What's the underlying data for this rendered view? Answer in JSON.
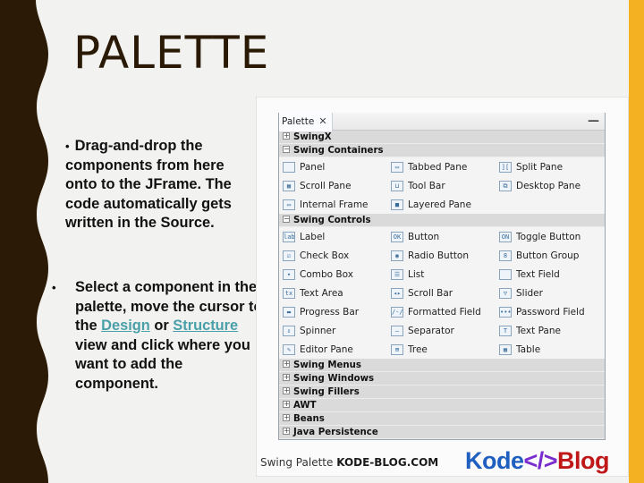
{
  "slide": {
    "title": "PALETTE",
    "colors": {
      "wave": "#2b1a05",
      "accent_strip": "#f4b223",
      "link": "#4aa0a8"
    }
  },
  "bullets": {
    "first": {
      "marker": "•",
      "text": "Drag-and-drop the components from here onto to the JFrame. The code automatically gets written in the Source."
    },
    "second": {
      "marker": "•",
      "text_before": "Select a component in the palette, move the cursor to the ",
      "link_design": "Design",
      "text_or": " or ",
      "link_structure": "Structure",
      "text_after": " view and click where you want to add the component."
    }
  },
  "palette": {
    "tab_label": "Palette",
    "close_glyph": "✕",
    "minimize_glyph": "—",
    "sections": {
      "swingx": {
        "toggle": "+",
        "label": "SwingX"
      },
      "containers": {
        "toggle": "−",
        "label": "Swing Containers",
        "items": [
          {
            "label": "Panel",
            "icon": "panel-icon",
            "glyph": ""
          },
          {
            "label": "Tabbed Pane",
            "icon": "tabbed-pane-icon",
            "glyph": "▭"
          },
          {
            "label": "Split Pane",
            "icon": "split-pane-icon",
            "glyph": "]["
          },
          {
            "label": "Scroll Pane",
            "icon": "scroll-pane-icon",
            "glyph": "▦"
          },
          {
            "label": "Tool Bar",
            "icon": "tool-bar-icon",
            "glyph": "⊔"
          },
          {
            "label": "Desktop Pane",
            "icon": "desktop-pane-icon",
            "glyph": "⧉"
          },
          {
            "label": "Internal Frame",
            "icon": "internal-frame-icon",
            "glyph": "▭"
          },
          {
            "label": "Layered Pane",
            "icon": "layered-pane-icon",
            "glyph": "■"
          }
        ]
      },
      "controls": {
        "toggle": "−",
        "label": "Swing Controls",
        "items": [
          {
            "label": "Label",
            "icon": "label-icon",
            "glyph": "labe"
          },
          {
            "label": "Button",
            "icon": "button-icon",
            "glyph": "OK"
          },
          {
            "label": "Toggle Button",
            "icon": "toggle-button-icon",
            "glyph": "ON"
          },
          {
            "label": "Check Box",
            "icon": "check-box-icon",
            "glyph": "☑"
          },
          {
            "label": "Radio Button",
            "icon": "radio-button-icon",
            "glyph": "◉"
          },
          {
            "label": "Button Group",
            "icon": "button-group-icon",
            "glyph": "8"
          },
          {
            "label": "Combo Box",
            "icon": "combo-box-icon",
            "glyph": "▾"
          },
          {
            "label": "List",
            "icon": "list-icon",
            "glyph": "☰"
          },
          {
            "label": "Text Field",
            "icon": "text-field-icon",
            "glyph": ""
          },
          {
            "label": "Text Area",
            "icon": "text-area-icon",
            "glyph": "tx"
          },
          {
            "label": "Scroll Bar",
            "icon": "scroll-bar-icon",
            "glyph": "◂▸"
          },
          {
            "label": "Slider",
            "icon": "slider-icon",
            "glyph": "▽"
          },
          {
            "label": "Progress Bar",
            "icon": "progress-bar-icon",
            "glyph": "▬"
          },
          {
            "label": "Formatted Field",
            "icon": "formatted-field-icon",
            "glyph": "/-/"
          },
          {
            "label": "Password Field",
            "icon": "password-field-icon",
            "glyph": "•••"
          },
          {
            "label": "Spinner",
            "icon": "spinner-icon",
            "glyph": "⇕"
          },
          {
            "label": "Separator",
            "icon": "separator-icon",
            "glyph": "—"
          },
          {
            "label": "Text Pane",
            "icon": "text-pane-icon",
            "glyph": "T"
          },
          {
            "label": "Editor Pane",
            "icon": "editor-pane-icon",
            "glyph": "✎"
          },
          {
            "label": "Tree",
            "icon": "tree-icon",
            "glyph": "⊞"
          },
          {
            "label": "Table",
            "icon": "table-icon",
            "glyph": "▦"
          }
        ]
      },
      "collapsed": [
        {
          "toggle": "+",
          "label": "Swing Menus"
        },
        {
          "toggle": "+",
          "label": "Swing Windows"
        },
        {
          "toggle": "+",
          "label": "Swing Fillers"
        },
        {
          "toggle": "+",
          "label": "AWT"
        },
        {
          "toggle": "+",
          "label": "Beans"
        },
        {
          "toggle": "+",
          "label": "Java Persistence"
        }
      ]
    }
  },
  "footer": {
    "caption_prefix": "Swing Palette ",
    "caption_site": "KODE-BLOG.COM",
    "logo": {
      "kode": "Kode",
      "tag": "</>",
      "blog": "Blog"
    }
  }
}
